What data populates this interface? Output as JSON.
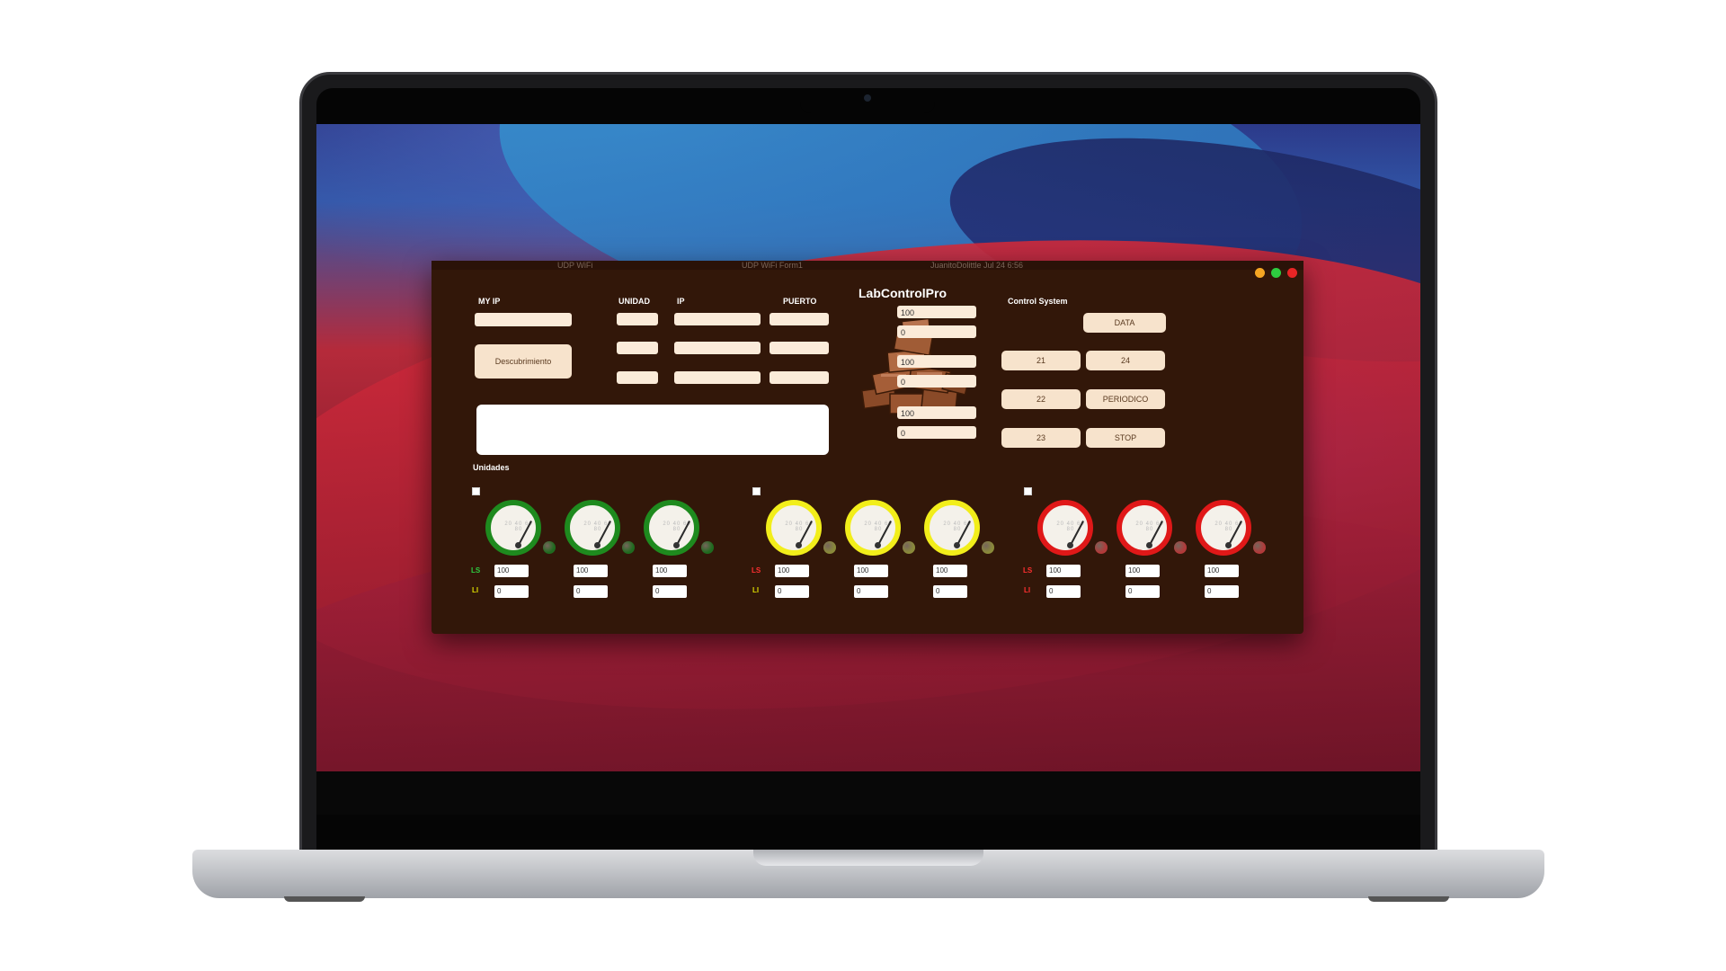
{
  "app": {
    "title": "LabControlPro"
  },
  "menubar_text": {
    "left": "UDP WiFi",
    "center": "UDP WiFi Form1",
    "right": "JuanitoDolittle Jul 24 6:56"
  },
  "config": {
    "my_ip_label": "MY IP",
    "unidad_label": "UNIDAD",
    "ip_label": "IP",
    "puerto_label": "PUERTO",
    "discover_button": "Descubrimiento",
    "unidades_label": "Unidades"
  },
  "limits_top": [
    {
      "ls": "100",
      "li": "0"
    },
    {
      "ls": "100",
      "li": "0"
    },
    {
      "ls": "100",
      "li": "0"
    }
  ],
  "control": {
    "title": "Control System",
    "data_button": "DATA",
    "buttons": [
      "21",
      "24",
      "22",
      "PERIODICO",
      "23",
      "STOP"
    ]
  },
  "groups": [
    {
      "color": "#1e8a1e",
      "led": "#1f6b1f",
      "ls_color": "#2ecc40",
      "li_color": "#d8d800",
      "units": [
        {
          "ls": "100",
          "li": "0"
        },
        {
          "ls": "100",
          "li": "0"
        },
        {
          "ls": "100",
          "li": "0"
        }
      ]
    },
    {
      "color": "#f2ee1a",
      "led": "#8a8a3a",
      "ls_color": "#ff3030",
      "li_color": "#d8d800",
      "units": [
        {
          "ls": "100",
          "li": "0"
        },
        {
          "ls": "100",
          "li": "0"
        },
        {
          "ls": "100",
          "li": "0"
        }
      ]
    },
    {
      "color": "#e01818",
      "led": "#b23a3a",
      "ls_color": "#ff3030",
      "li_color": "#ff3030",
      "units": [
        {
          "ls": "100",
          "li": "0"
        },
        {
          "ls": "100",
          "li": "0"
        },
        {
          "ls": "100",
          "li": "0"
        }
      ]
    }
  ],
  "labels": {
    "ls": "LS",
    "li": "LI"
  },
  "gauge_scale": "20 40 60 80",
  "colors": {
    "window_bg": "#321709",
    "field_bg": "#fbebd9",
    "button_bg": "#f7e3cc"
  }
}
